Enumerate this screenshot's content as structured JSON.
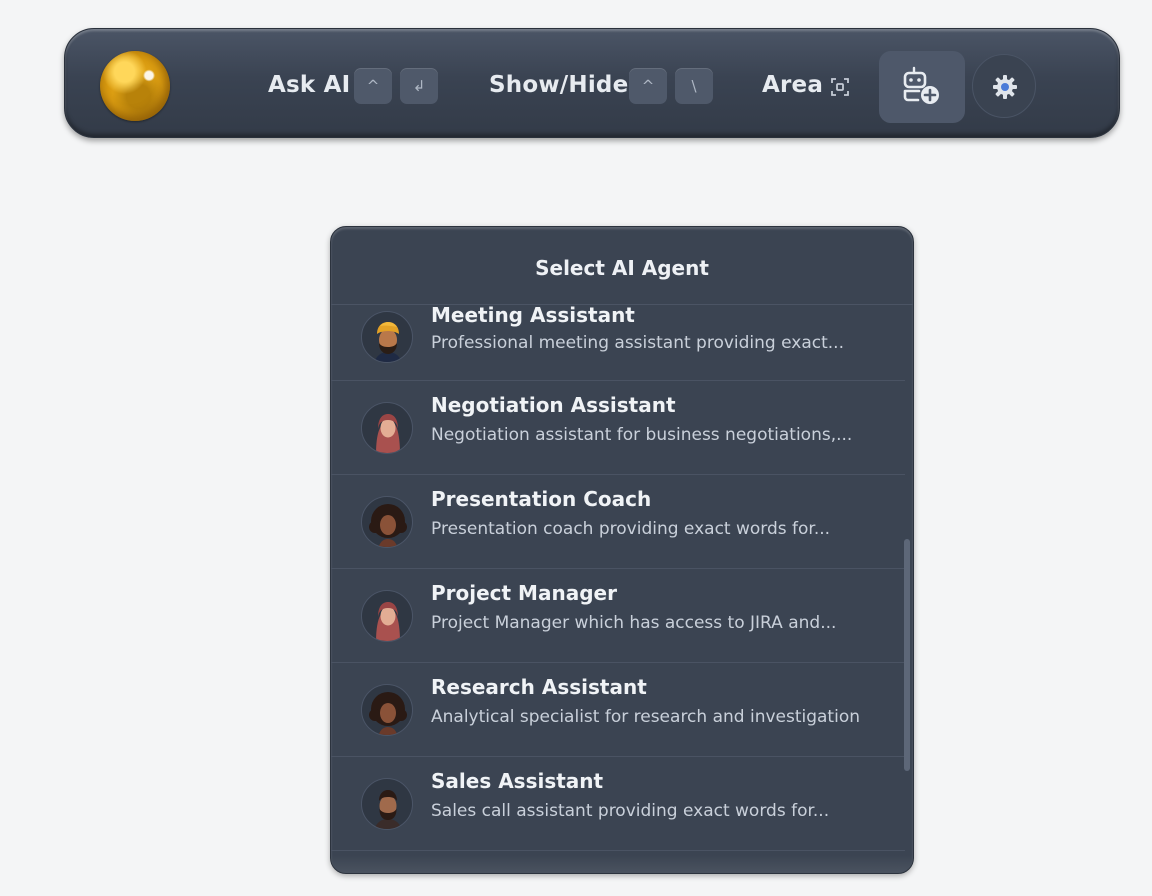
{
  "toolbar": {
    "logo_icon": "gold-orb-icon",
    "ask_ai_label": "Ask AI",
    "ask_ai_keys": [
      "^",
      "↲"
    ],
    "show_hide_label": "Show/Hide",
    "show_hide_keys": [
      "^",
      "\\"
    ],
    "area_label": "Area",
    "area_icon": "screen-capture-icon",
    "agent_icon": "robot-add-icon",
    "settings_icon": "gear-icon"
  },
  "agent_panel": {
    "title": "Select AI Agent",
    "agents": [
      {
        "name": "Meeting Assistant",
        "description": "Professional meeting assistant providing exact...",
        "avatar": "turban-man-avatar"
      },
      {
        "name": "Negotiation Assistant",
        "description": "Negotiation assistant for business negotiations,...",
        "avatar": "hijab-woman-avatar"
      },
      {
        "name": "Presentation Coach",
        "description": "Presentation coach providing exact words for...",
        "avatar": "curly-hair-woman-avatar"
      },
      {
        "name": "Project Manager",
        "description": "Project Manager which has access to JIRA and...",
        "avatar": "hijab-woman-avatar"
      },
      {
        "name": "Research Assistant",
        "description": "Analytical specialist for research and investigation",
        "avatar": "curly-hair-woman-avatar"
      },
      {
        "name": "Sales Assistant",
        "description": "Sales call assistant providing exact words for...",
        "avatar": "bearded-man-avatar"
      }
    ]
  },
  "colors": {
    "panel_bg": "#3b4452",
    "toolbar_bg": "#3a4352",
    "accent_orb": "#f0b420",
    "settings_accent": "#4a7bd8"
  }
}
